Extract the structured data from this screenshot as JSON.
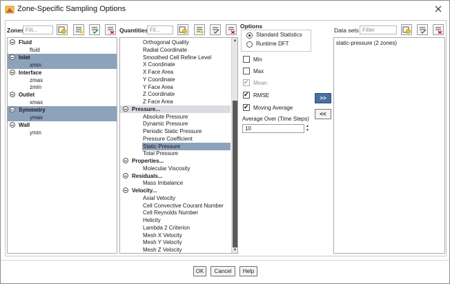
{
  "window": {
    "title": "Zone-Specific Sampling Options"
  },
  "zones": {
    "label": "Zones",
    "filter_placeholder": "Filt...",
    "tree": [
      {
        "name": "Fluid",
        "selected": false,
        "children": [
          {
            "name": "fluid",
            "selected": false
          }
        ]
      },
      {
        "name": "Inlet",
        "selected": true,
        "children": [
          {
            "name": "xmin",
            "selected": true
          }
        ]
      },
      {
        "name": "Interface",
        "selected": false,
        "children": [
          {
            "name": "zmax",
            "selected": false
          },
          {
            "name": "zmin",
            "selected": false
          }
        ]
      },
      {
        "name": "Outlet",
        "selected": false,
        "children": [
          {
            "name": "xmax",
            "selected": false
          }
        ]
      },
      {
        "name": "Symmetry",
        "selected": true,
        "children": [
          {
            "name": "ymax",
            "selected": true
          }
        ]
      },
      {
        "name": "Wall",
        "selected": false,
        "children": [
          {
            "name": "ymin",
            "selected": false
          }
        ]
      }
    ]
  },
  "quantities": {
    "label": "Quantities",
    "filter_placeholder": "Fil...",
    "rows": [
      {
        "kind": "item",
        "text": "Orthogonal Quality"
      },
      {
        "kind": "item",
        "text": "Radial Coordinate"
      },
      {
        "kind": "item",
        "text": "Smoothed Cell Refine Level"
      },
      {
        "kind": "item",
        "text": "X Coordinate"
      },
      {
        "kind": "item",
        "text": "X Face Area"
      },
      {
        "kind": "item",
        "text": "Y Coordinate"
      },
      {
        "kind": "item",
        "text": "Y Face Area"
      },
      {
        "kind": "item",
        "text": "Z Coordinate"
      },
      {
        "kind": "item",
        "text": "Z Face Area"
      },
      {
        "kind": "header",
        "text": "Pressure...",
        "state": "parent"
      },
      {
        "kind": "item",
        "text": "Absolute Pressure"
      },
      {
        "kind": "item",
        "text": "Dynamic Pressure"
      },
      {
        "kind": "item",
        "text": "Periodic Static Pressure"
      },
      {
        "kind": "item",
        "text": "Pressure Coefficient"
      },
      {
        "kind": "item",
        "text": "Static Pressure",
        "state": "selected"
      },
      {
        "kind": "item",
        "text": "Total Pressure"
      },
      {
        "kind": "header",
        "text": "Properties..."
      },
      {
        "kind": "item",
        "text": "Molecular Viscosity"
      },
      {
        "kind": "header",
        "text": "Residuals..."
      },
      {
        "kind": "item",
        "text": "Mass Imbalance"
      },
      {
        "kind": "header",
        "text": "Velocity..."
      },
      {
        "kind": "item",
        "text": "Axial Velocity"
      },
      {
        "kind": "item",
        "text": "Cell Convective Courant Number"
      },
      {
        "kind": "item",
        "text": "Cell Reynolds Number"
      },
      {
        "kind": "item",
        "text": "Helicity"
      },
      {
        "kind": "item",
        "text": "Lambda 2 Criterion"
      },
      {
        "kind": "item",
        "text": "Mesh X Velocity"
      },
      {
        "kind": "item",
        "text": "Mesh Y Velocity"
      },
      {
        "kind": "item",
        "text": "Mesh Z Velocity"
      }
    ],
    "scroll_position_fraction": 0.72
  },
  "options": {
    "label": "Options",
    "statistics": [
      {
        "label": "Standard Statistics",
        "checked": true
      },
      {
        "label": "Runtime DFT",
        "checked": false
      }
    ],
    "checkboxes": [
      {
        "label": "Min",
        "checked": false,
        "disabled": false
      },
      {
        "label": "Max",
        "checked": false,
        "disabled": false
      },
      {
        "label": "Mean",
        "checked": true,
        "disabled": true
      },
      {
        "label": "RMSE",
        "checked": true,
        "disabled": false
      },
      {
        "label": "Moving Average",
        "checked": true,
        "disabled": false
      }
    ],
    "average_over_label": "Average Over (Time Steps)",
    "average_over_value": "10"
  },
  "transfer": {
    "add_label": ">>",
    "remove_label": "<<"
  },
  "datasets": {
    "label": "Data sets",
    "filter_placeholder": "Filter",
    "items": [
      "static-pressure (2 zones)"
    ]
  },
  "footer": {
    "ok": "OK",
    "cancel": "Cancel",
    "help": "Help"
  },
  "colors": {
    "selection": "#8da2bb",
    "primary_button": "#4a6fa0",
    "scroll_thumb": "#5a5a5a"
  }
}
